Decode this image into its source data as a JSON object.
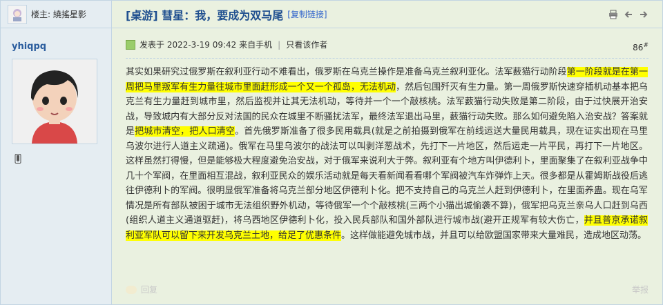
{
  "lz_bar": {
    "label": "楼主: 繞搖星影"
  },
  "user": {
    "name": "yhiqpq"
  },
  "thread": {
    "title": "[桌游] 彗星：我，要成为双马尾",
    "copy_link": "[复制链接]"
  },
  "post": {
    "posted": "发表于 2022-3-19 09:42 来自手机",
    "author_only": "只看该作者",
    "floor": "86",
    "floor_sup": "#",
    "segments": [
      {
        "text": "其实如果研究过俄罗斯在叙利亚行动不难看出，俄罗斯在乌克兰操作是准备乌克兰叙利亚化。法军薮猫行动阶段",
        "hl": false
      },
      {
        "text": "第一阶段就是在第一周把马里叛军有生力量往城市里面赶形成一个又一个孤岛，无法机动",
        "hl": true
      },
      {
        "text": "，然后包围歼灭有生力量。第一周俄罗斯快速穿插机动基本把乌克兰有生力量赶到城市里，然后监视并让其无法机动，等待并一个一个敲核桃。法军薮猫行动失败是第二阶段，由于过快展开治安战，导致城内有大部分反对法国的民众在城里不断骚扰法军，最终法军退出马里，薮猫行动失败。那么如何避免陷入治安战？答案就是",
        "hl": false
      },
      {
        "text": "把城市清空，把人口清空",
        "hl": true
      },
      {
        "text": "。首先俄罗斯准备了很多民用载具(就是之前拍摄到俄军在前线运送大量民用载具，现在证实出现在马里乌波尔进行人道主义疏通)。俄军在马里乌波尔的战法可以叫剥洋葱战术，先打下一片地区，然后运走一片平民，再打下一片地区。这样虽然打得慢，但是能够极大程度避免治安战，对于俄军来说利大于弊。叙利亚有个地方叫伊德利卜，里面聚集了在叙利亚战争中几十个军阀，在里面相互混战，叙利亚民众的娱乐活动就是每天看新闻看看哪个军阀被汽车炸弹炸上天。很多都是从霍姆斯战役后逃往伊德利卜的军阀。很明显俄军准备将乌克兰部分地区伊德利卜化。把不支持自己的乌克兰人赶到伊德利卜，在里面养蛊。现在乌军情况是所有部队被困于城市无法组织野外机动，等待俄军一个个敲核桃(三两个小猫出城偷袭不算)，俄军把乌克兰亲乌人口赶到乌西(组织人道主义通道驱赶)，将乌西地区伊德利卜化，投入民兵部队和国外部队进行城市战(避开正规军有较大伤亡，",
        "hl": false
      },
      {
        "text": "并且普京承诺叙利亚军队可以留下来开发乌克兰土地，给足了优惠条件",
        "hl": true
      },
      {
        "text": "。这样做能避免城市战，并且可以给欧盟国家带来大量难民，造成地区动荡。",
        "hl": false
      }
    ]
  },
  "footer": {
    "reply": "回复",
    "report": "举报"
  },
  "colors": {
    "highlight": "#ffff00",
    "title": "#1f4f8f",
    "username": "#2b5d9e",
    "sidebar_bg": "#e5edf2",
    "post_bg": "#eaf1e0"
  },
  "icons": [
    "avatar-icon",
    "print-icon",
    "prev-arrow-icon",
    "next-arrow-icon",
    "online-status-icon",
    "mobile-phone-icon",
    "reply-icon"
  ]
}
